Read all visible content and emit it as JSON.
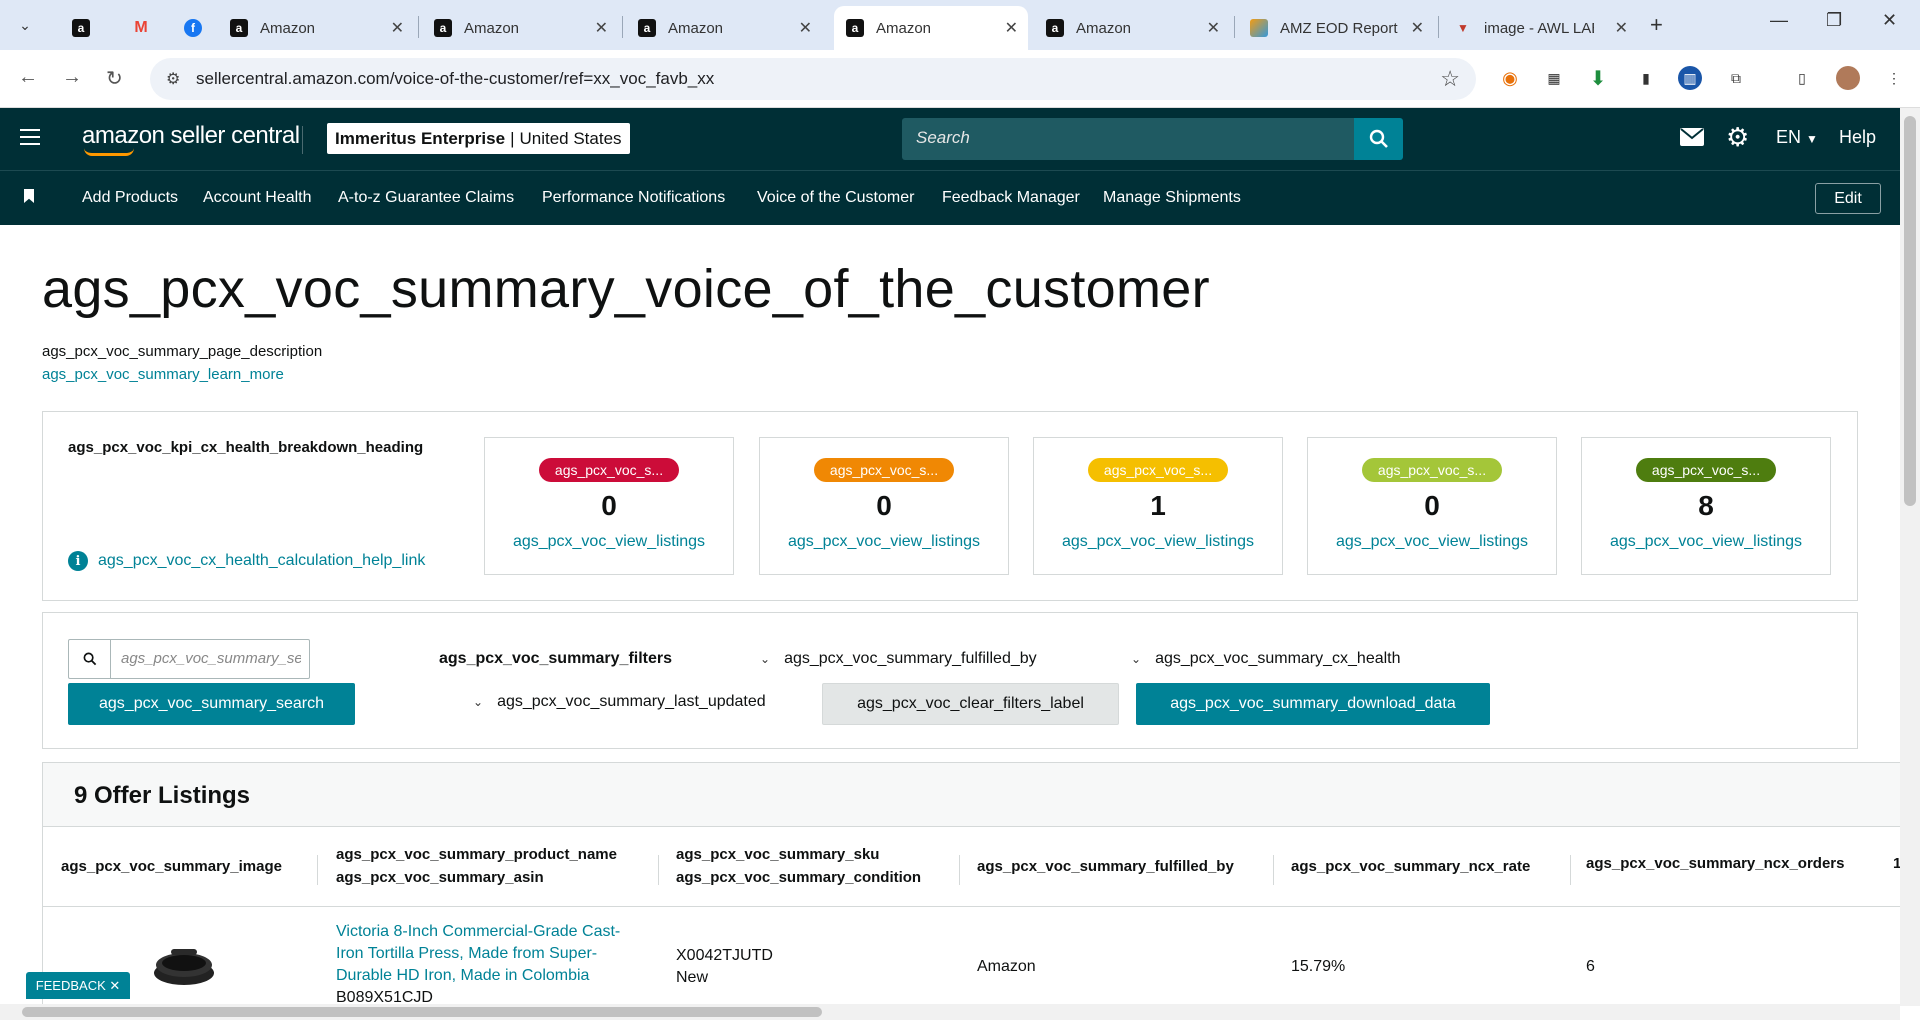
{
  "browser": {
    "tabs": [
      {
        "title": "",
        "icon": "amazon-icon"
      },
      {
        "title": "",
        "icon": "gmail-icon"
      },
      {
        "title": "",
        "icon": "facebook-icon"
      },
      {
        "title": "Amazon",
        "icon": "amazon-icon"
      },
      {
        "title": "Amazon",
        "icon": "amazon-icon"
      },
      {
        "title": "Amazon",
        "icon": "amazon-icon"
      },
      {
        "title": "Amazon",
        "icon": "amazon-icon",
        "active": true
      },
      {
        "title": "Amazon",
        "icon": "amazon-icon"
      },
      {
        "title": "AMZ EOD Report",
        "icon": "report-icon"
      },
      {
        "title": "image - AWL LAB",
        "icon": "awl-icon"
      }
    ],
    "url": "sellercentral.amazon.com/voice-of-the-customer/ref=xx_voc_favb_xx"
  },
  "header": {
    "logo_text": "amazon seller central",
    "account_name": "Immeritus Enterprise",
    "account_sep": "|",
    "account_region": "United States",
    "search_placeholder": "Search",
    "lang": "EN",
    "help": "Help"
  },
  "nav": {
    "items": [
      "Add Products",
      "Account Health",
      "A-to-z Guarantee Claims",
      "Performance Notifications",
      "Voice of the Customer",
      "Feedback Manager",
      "Manage Shipments"
    ],
    "edit": "Edit"
  },
  "page": {
    "title": "ags_pcx_voc_summary_voice_of_the_customer",
    "description": "ags_pcx_voc_summary_page_description",
    "learn_more": "ags_pcx_voc_summary_learn_more"
  },
  "kpi": {
    "heading": "ags_pcx_voc_kpi_cx_health_breakdown_heading",
    "help_link": "ags_pcx_voc_cx_health_calculation_help_link",
    "cards": [
      {
        "badge": "ags_pcx_voc_s...",
        "color": "#cc0c39",
        "count": "0",
        "link": "ags_pcx_voc_view_listings"
      },
      {
        "badge": "ags_pcx_voc_s...",
        "color": "#f08804",
        "count": "0",
        "link": "ags_pcx_voc_view_listings"
      },
      {
        "badge": "ags_pcx_voc_s...",
        "color": "#f5bf00",
        "count": "1",
        "link": "ags_pcx_voc_view_listings"
      },
      {
        "badge": "ags_pcx_voc_s...",
        "color": "#a4c639",
        "count": "0",
        "link": "ags_pcx_voc_view_listings"
      },
      {
        "badge": "ags_pcx_voc_s...",
        "color": "#4e7d0f",
        "count": "8",
        "link": "ags_pcx_voc_view_listings"
      }
    ]
  },
  "filters": {
    "search_placeholder": "ags_pcx_voc_summary_search",
    "search_button": "ags_pcx_voc_summary_search",
    "label": "ags_pcx_voc_summary_filters",
    "fulfilled_by": "ags_pcx_voc_summary_fulfilled_by",
    "cx_health": "ags_pcx_voc_summary_cx_health",
    "last_updated": "ags_pcx_voc_summary_last_updated",
    "clear": "ags_pcx_voc_clear_filters_label",
    "download": "ags_pcx_voc_summary_download_data"
  },
  "listings": {
    "title": "9 Offer Listings",
    "columns": {
      "image": "ags_pcx_voc_summary_image",
      "product_name": "ags_pcx_voc_summary_product_name",
      "asin": "ags_pcx_voc_summary_asin",
      "sku": "ags_pcx_voc_summary_sku",
      "condition": "ags_pcx_voc_summary_condition",
      "fulfilled_by": "ags_pcx_voc_summary_fulfilled_by",
      "ncx_rate": "ags_pcx_voc_summary_ncx_rate",
      "ncx_orders": "ags_pcx_voc_summary_ncx_orders",
      "next": "1"
    },
    "rows": [
      {
        "product_name": "Victoria 8-Inch Commercial-Grade Cast-Iron Tortilla Press, Made from Super-Durable HD Iron, Made in Colombia",
        "asin": "B089X51CJD",
        "sku": "X0042TJUTD",
        "condition": "New",
        "fulfilled_by": "Amazon",
        "ncx_rate": "15.79%",
        "ncx_orders": "6"
      }
    ]
  },
  "feedback": {
    "label": "FEEDBACK",
    "close": "✕"
  }
}
